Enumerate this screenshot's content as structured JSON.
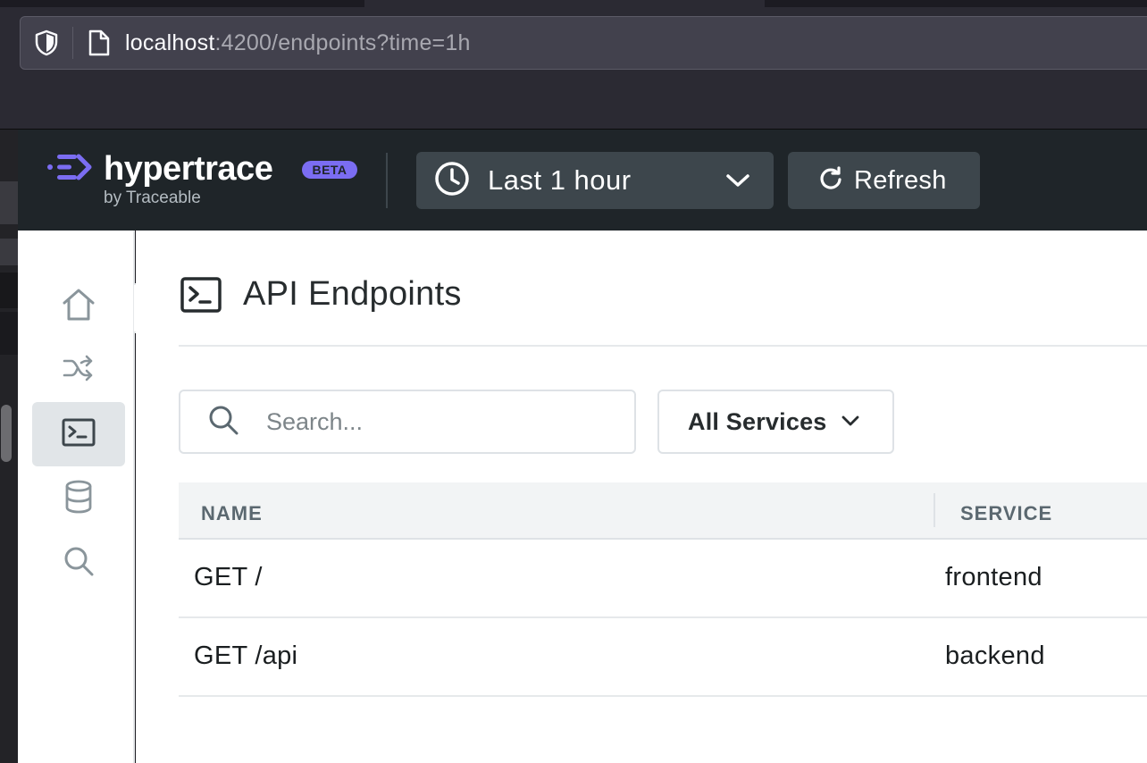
{
  "browser": {
    "url_host": "localhost",
    "url_rest": ":4200/endpoints?time=1h",
    "icons": [
      "shield-icon",
      "page-icon"
    ]
  },
  "header": {
    "brand": "hypertrace",
    "badge": "BETA",
    "tagline": "by Traceable",
    "time_range_label": "Last 1 hour",
    "refresh_label": "Refresh"
  },
  "nav": {
    "items": [
      {
        "name": "home",
        "icon": "home-icon",
        "active": false
      },
      {
        "name": "application-flow",
        "icon": "shuffle-icon",
        "active": false
      },
      {
        "name": "api-endpoints",
        "icon": "terminal-icon",
        "active": true
      },
      {
        "name": "backends",
        "icon": "database-icon",
        "active": false
      },
      {
        "name": "explorer",
        "icon": "search-icon",
        "active": false
      }
    ]
  },
  "main": {
    "title": "API Endpoints",
    "search_placeholder": "Search...",
    "service_filter": "All Services",
    "table": {
      "columns": [
        "NAME",
        "SERVICE"
      ],
      "rows": [
        {
          "name": "GET /",
          "service": "frontend"
        },
        {
          "name": "GET /api",
          "service": "backend"
        }
      ]
    }
  },
  "colors": {
    "header_bg": "#1f2529",
    "button_bg": "#3d464c",
    "brand_accent": "#7b6df2",
    "active_nav_bg": "#e1e5e8"
  }
}
